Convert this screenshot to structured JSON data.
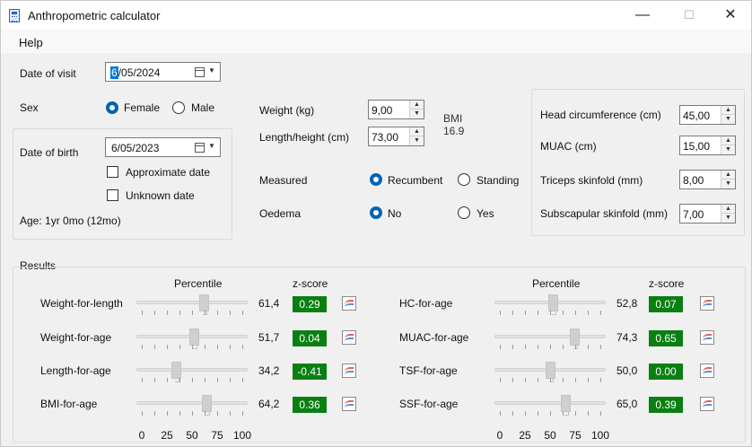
{
  "window": {
    "title": "Anthropometric calculator",
    "minimize": "—",
    "maximize": "☐",
    "close": "✕"
  },
  "menu": {
    "help": "Help"
  },
  "visit": {
    "label": "Date of visit",
    "value": "6/05/2024",
    "caret_text": "6",
    "rest_text": "/05/2024"
  },
  "sex": {
    "label": "Sex",
    "options": [
      "Female",
      "Male"
    ],
    "selected": "Female"
  },
  "birth": {
    "label": "Date of birth",
    "value": "6/05/2023",
    "approximate_label": "Approximate date",
    "unknown_label": "Unknown date",
    "age": "Age: 1yr 0mo (12mo)"
  },
  "measures": {
    "weight_label": "Weight (kg)",
    "weight": "9,00",
    "length_label": "Length/height (cm)",
    "length": "73,00",
    "bmi_label": "BMI",
    "bmi_value": "16.9",
    "measured_label": "Measured",
    "measured_options": [
      "Recumbent",
      "Standing"
    ],
    "measured_selected": "Recumbent",
    "oedema_label": "Oedema",
    "oedema_options": [
      "No",
      "Yes"
    ],
    "oedema_selected": "No"
  },
  "circumferences": {
    "head_label": "Head circumference (cm)",
    "head": "45,00",
    "muac_label": "MUAC (cm)",
    "muac": "15,00",
    "triceps_label": "Triceps skinfold (mm)",
    "triceps": "8,00",
    "subscap_label": "Subscapular skinfold (mm)",
    "subscap": "7,00"
  },
  "results": {
    "label": "Results",
    "percentile_header": "Percentile",
    "zscore_header": "z-score",
    "axis_labels": [
      "0",
      "25",
      "50",
      "75",
      "100"
    ],
    "left": [
      {
        "name": "Weight-for-length",
        "percentile": 61.4,
        "percentile_text": "61,4",
        "z": "0.29"
      },
      {
        "name": "Weight-for-age",
        "percentile": 51.7,
        "percentile_text": "51,7",
        "z": "0.04"
      },
      {
        "name": "Length-for-age",
        "percentile": 34.2,
        "percentile_text": "34,2",
        "z": "-0.41"
      },
      {
        "name": "BMI-for-age",
        "percentile": 64.2,
        "percentile_text": "64,2",
        "z": "0.36"
      }
    ],
    "right": [
      {
        "name": "HC-for-age",
        "percentile": 52.8,
        "percentile_text": "52,8",
        "z": "0.07"
      },
      {
        "name": "MUAC-for-age",
        "percentile": 74.3,
        "percentile_text": "74,3",
        "z": "0.65"
      },
      {
        "name": "TSF-for-age",
        "percentile": 50.0,
        "percentile_text": "50,0",
        "z": "0.00"
      },
      {
        "name": "SSF-for-age",
        "percentile": 65.0,
        "percentile_text": "65,0",
        "z": "0.39"
      }
    ]
  },
  "colors": {
    "accent": "#0063b1",
    "zscore_bg": "#0a7f12"
  }
}
